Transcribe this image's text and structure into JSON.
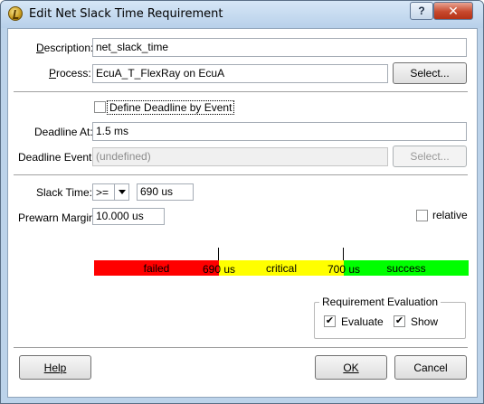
{
  "window": {
    "title": "Edit Net Slack Time Requirement",
    "help_glyph": "?",
    "close_glyph": "✕"
  },
  "form": {
    "description": {
      "label": "Description:",
      "value": "net_slack_time"
    },
    "process": {
      "label": "Process:",
      "value": "EcuA_T_FlexRay on EcuA",
      "button": "Select..."
    },
    "define_deadline": {
      "label": "Define Deadline by Event",
      "checked": false
    },
    "deadline_at": {
      "label": "Deadline At:",
      "value": "1.5 ms"
    },
    "deadline_event": {
      "label": "Deadline Event:",
      "value": "(undefined)",
      "button": "Select..."
    },
    "slack_time": {
      "label": "Slack Time:",
      "operator": ">=",
      "value": "690 us"
    },
    "prewarn_margin": {
      "label": "Prewarn Margin:",
      "value": "10.000 us"
    },
    "relative": {
      "label": "relative",
      "checked": false
    }
  },
  "threshold_bar": {
    "segments": [
      {
        "label": "failed",
        "color": "#ff0000"
      },
      {
        "label": "critical",
        "color": "#ffff00"
      },
      {
        "label": "success",
        "color": "#00ff00"
      }
    ],
    "ticks": [
      "690 us",
      "700 us"
    ]
  },
  "requirement_evaluation": {
    "title": "Requirement Evaluation",
    "evaluate": {
      "label": "Evaluate",
      "checked": true
    },
    "show": {
      "label": "Show",
      "checked": true
    }
  },
  "buttons": {
    "help": "Help",
    "ok": "OK",
    "cancel": "Cancel"
  }
}
